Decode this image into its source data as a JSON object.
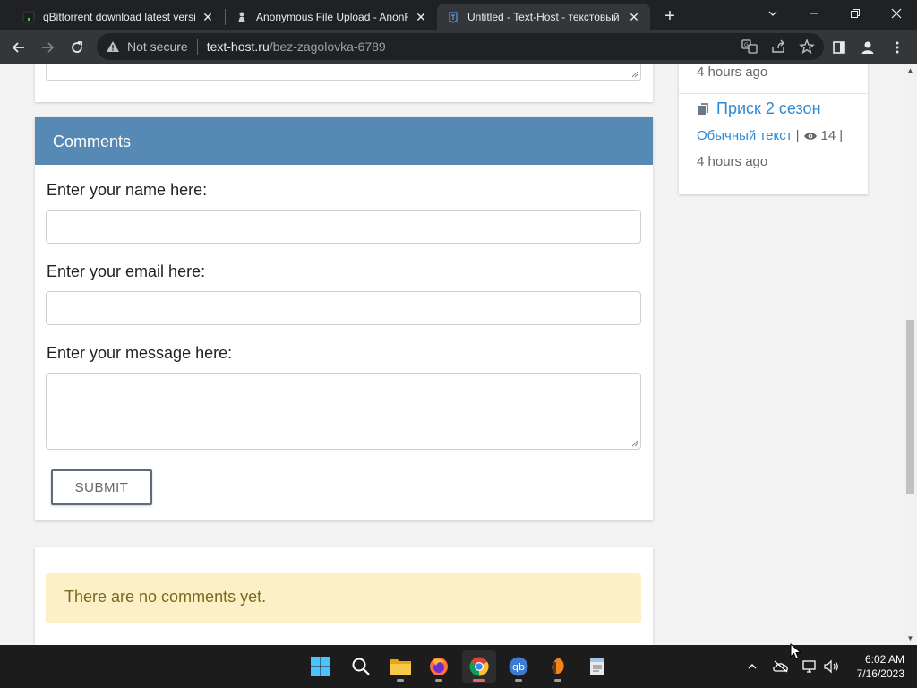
{
  "browser": {
    "tabs": [
      {
        "title": "qBittorrent download latest versi",
        "active": false
      },
      {
        "title": "Anonymous File Upload - AnonFi",
        "active": false
      },
      {
        "title": "Untitled - Text-Host - текстовый",
        "active": true
      }
    ],
    "address": {
      "security_label": "Not secure",
      "host": "text-host.ru",
      "path": "/bez-zagolovka-6789"
    }
  },
  "comments": {
    "header": "Comments",
    "name_label": "Enter your name here:",
    "name_value": "",
    "email_label": "Enter your email here:",
    "email_value": "",
    "message_label": "Enter your message here:",
    "message_value": "",
    "submit_label": "SUBMIT",
    "empty_notice": "There are no comments yet."
  },
  "sidebar": {
    "prev_time": "4 hours ago",
    "item": {
      "title": "Приск 2 сезон",
      "category": "Обычный текст",
      "separator": "|",
      "views": "14",
      "time": "4 hours ago"
    }
  },
  "taskbar": {
    "apps": [
      "start",
      "search",
      "file-explorer",
      "firefox",
      "chrome",
      "qbittorrent",
      "fl-studio",
      "notepad"
    ],
    "active_app": "chrome",
    "time": "6:02 AM",
    "date": "7/16/2023"
  },
  "colors": {
    "comments_header": "#5689b4",
    "link": "#2c8ad5",
    "notice_bg": "#fcf0c6"
  }
}
